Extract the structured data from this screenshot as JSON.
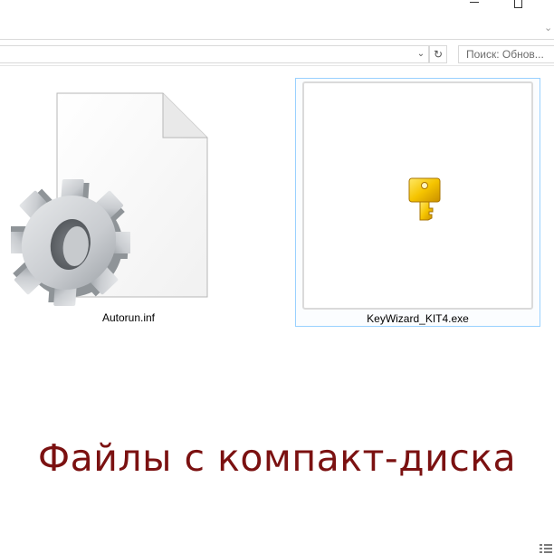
{
  "window": {
    "minimize_icon": "minimize-icon",
    "maximize_icon": "maximize-icon",
    "ribbon_toggle": "⌄"
  },
  "navigation": {
    "address_value": "",
    "refresh_icon": "↻",
    "dropdown_icon": "⌄",
    "search_placeholder": "Поиск: Обнов..."
  },
  "files": [
    {
      "name": "Autorun.inf",
      "icon": "settings-file-icon"
    },
    {
      "name": "KeyWizard_KIT4.exe",
      "icon": "key-icon",
      "selected": true
    }
  ],
  "caption": "Файлы с компакт-диска",
  "colors": {
    "caption": "#7b1111",
    "selection_border": "#99d1ff",
    "key_gold": "#e8b400"
  }
}
